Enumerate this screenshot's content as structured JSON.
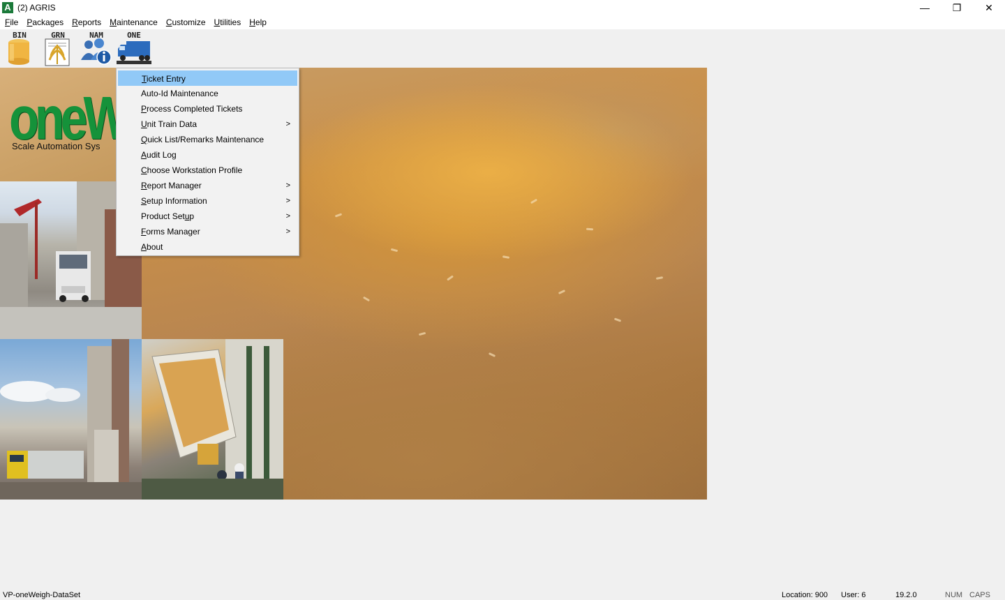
{
  "window": {
    "app_icon_letter": "A",
    "title": "(2) AGRIS",
    "controls": {
      "minimize": "—",
      "restore": "❐",
      "close": "✕"
    }
  },
  "menubar": [
    {
      "acc": "F",
      "rest": "ile"
    },
    {
      "acc": "P",
      "rest": "ackages"
    },
    {
      "acc": "R",
      "rest": "eports"
    },
    {
      "acc": "M",
      "rest": "aintenance"
    },
    {
      "acc": "C",
      "rest": "ustomize"
    },
    {
      "acc": "U",
      "rest": "tilities"
    },
    {
      "acc": "H",
      "rest": "elp"
    }
  ],
  "toolbar": {
    "bin_label": "BIN",
    "grn_label": "GRN",
    "nam_label": "NAM",
    "one_label": "ONE"
  },
  "splash": {
    "logo_text": "oneWe",
    "logo_subtitle": "Scale Automation Sys"
  },
  "dropdown": [
    {
      "pre": "",
      "acc": "T",
      "post": "icket Entry",
      "submenu": false,
      "active": true
    },
    {
      "pre": "Auto-Id Maintenance",
      "acc": "",
      "post": "",
      "submenu": false,
      "active": false
    },
    {
      "pre": "",
      "acc": "P",
      "post": "rocess Completed Tickets",
      "submenu": false,
      "active": false
    },
    {
      "pre": "",
      "acc": "U",
      "post": "nit Train Data",
      "submenu": true,
      "active": false
    },
    {
      "pre": "",
      "acc": "Q",
      "post": "uick List/Remarks Maintenance",
      "submenu": false,
      "active": false
    },
    {
      "pre": "",
      "acc": "A",
      "post": "udit Log",
      "submenu": false,
      "active": false
    },
    {
      "pre": "",
      "acc": "C",
      "post": "hoose Workstation Profile",
      "submenu": false,
      "active": false
    },
    {
      "pre": "",
      "acc": "R",
      "post": "eport Manager",
      "submenu": true,
      "active": false
    },
    {
      "pre": "",
      "acc": "S",
      "post": "etup Information",
      "submenu": true,
      "active": false
    },
    {
      "pre": "Product Set",
      "acc": "u",
      "post": "p",
      "submenu": true,
      "active": false
    },
    {
      "pre": "",
      "acc": "F",
      "post": "orms Manager",
      "submenu": true,
      "active": false
    },
    {
      "pre": "",
      "acc": "A",
      "post": "bout",
      "submenu": false,
      "active": false
    }
  ],
  "statusbar": {
    "dataset": "VP-oneWeigh-DataSet",
    "location": "Location: 900",
    "user": "User: 6",
    "version": "19.2.0",
    "num": "NUM",
    "caps": "CAPS"
  },
  "colors": {
    "menu_highlight": "#91c9f7",
    "logo_green": "#15923a"
  }
}
